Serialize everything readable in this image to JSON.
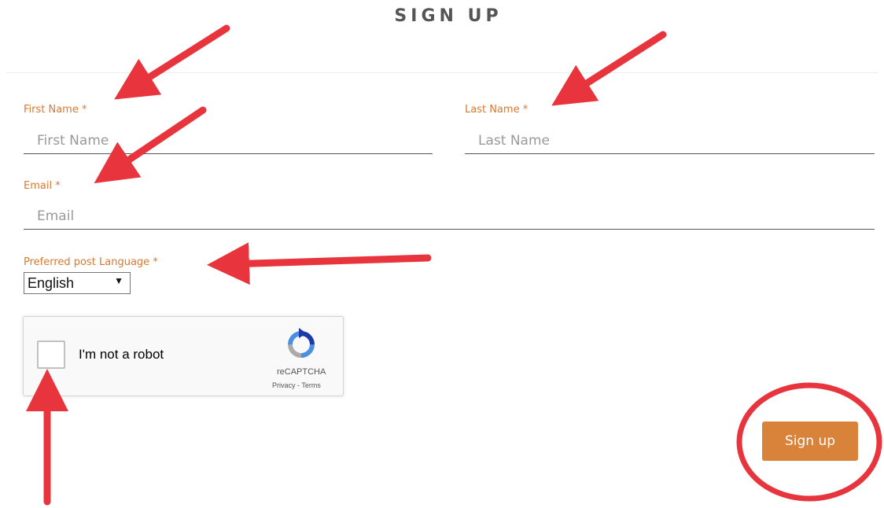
{
  "form": {
    "title": "SIGN UP",
    "first_name": {
      "label": "First Name",
      "required_mark": "*",
      "placeholder": "First Name"
    },
    "last_name": {
      "label": "Last Name",
      "required_mark": "*",
      "placeholder": "Last Name"
    },
    "email": {
      "label": "Email",
      "required_mark": "*",
      "placeholder": "Email"
    },
    "language": {
      "label": "Preferred post Language",
      "required_mark": "*",
      "selected": "English",
      "caret": "▼"
    },
    "captcha": {
      "checkbox_label": "I'm not a robot",
      "brand": "reCAPTCHA",
      "links": "Privacy - Terms"
    },
    "submit_label": "Sign up"
  },
  "colors": {
    "label": "#d9782f",
    "button": "#d9833a",
    "annotation": "#e8353d"
  }
}
